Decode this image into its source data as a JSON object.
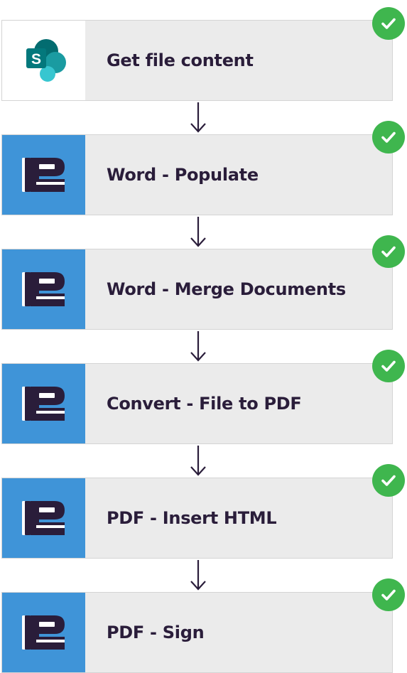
{
  "flow": {
    "steps": [
      {
        "label": "Get file content",
        "icon": "sharepoint-icon",
        "status": "succeeded"
      },
      {
        "label": "Word - Populate",
        "icon": "document-connector-icon",
        "status": "succeeded"
      },
      {
        "label": "Word - Merge Documents",
        "icon": "document-connector-icon",
        "status": "succeeded"
      },
      {
        "label": "Convert - File to PDF",
        "icon": "document-connector-icon",
        "status": "succeeded"
      },
      {
        "label": "PDF - Insert HTML",
        "icon": "document-connector-icon",
        "status": "succeeded"
      },
      {
        "label": "PDF - Sign",
        "icon": "document-connector-icon",
        "status": "succeeded"
      }
    ],
    "connector": "arrow-down-icon"
  },
  "colors": {
    "card_background": "#ebebeb",
    "connector_tile": "#3f94d8",
    "label_text": "#2a1d3a",
    "success": "#3fb64e",
    "arrow": "#2a1d3a",
    "sharepoint_dark": "#036c70",
    "sharepoint_mid": "#1a9ba1",
    "sharepoint_light": "#37c6d0"
  }
}
